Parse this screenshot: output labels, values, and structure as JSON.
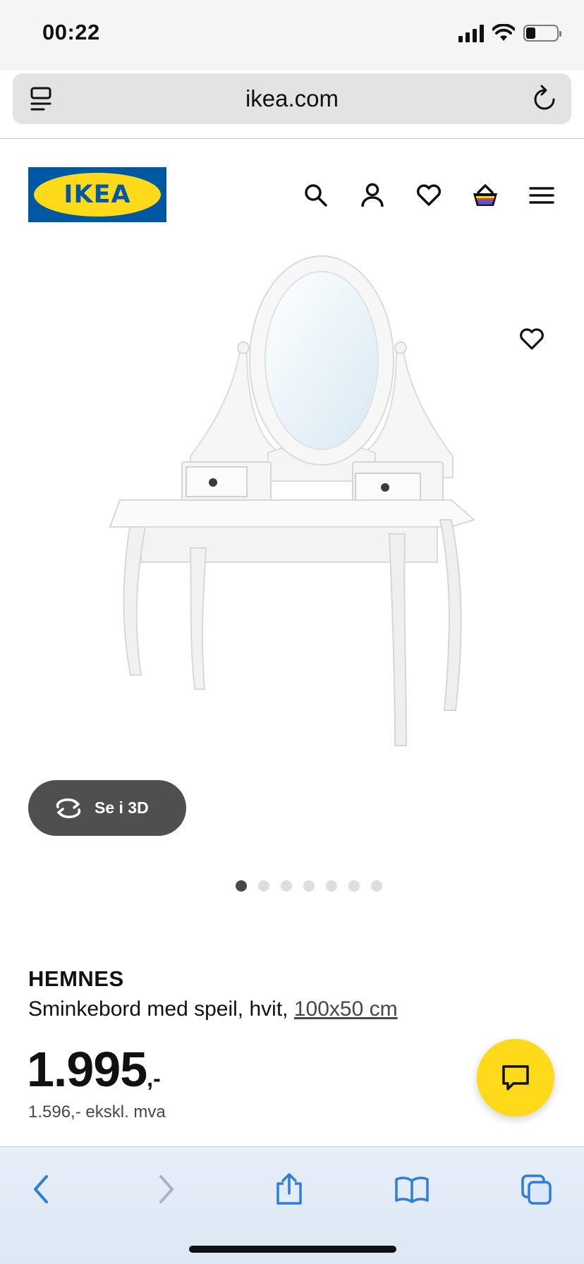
{
  "status_bar": {
    "time": "00:22",
    "battery_level": 0.3
  },
  "browser": {
    "url": "ikea.com",
    "icons": [
      "reader-icon",
      "reload-icon"
    ]
  },
  "site": {
    "logo_text": "IKEA",
    "colors": {
      "brand_blue": "#0058a3",
      "brand_yellow": "#ffda1a"
    },
    "header_icons": [
      "search-icon",
      "account-icon",
      "favourites-icon",
      "cart-icon",
      "menu-icon"
    ]
  },
  "product": {
    "view3d_label": "Se i 3D",
    "carousel": {
      "total": 7,
      "active_index": 0
    },
    "name": "HEMNES",
    "description": "Sminkebord med speil, hvit, ",
    "size": "100x50 cm",
    "price": "1.995",
    "price_suffix": ",-",
    "price_excl_vat": "1.596,- ekskl. mva"
  },
  "bottom_nav": {
    "icons": [
      "back-icon",
      "forward-icon",
      "share-icon",
      "bookmarks-icon",
      "tabs-icon"
    ]
  }
}
